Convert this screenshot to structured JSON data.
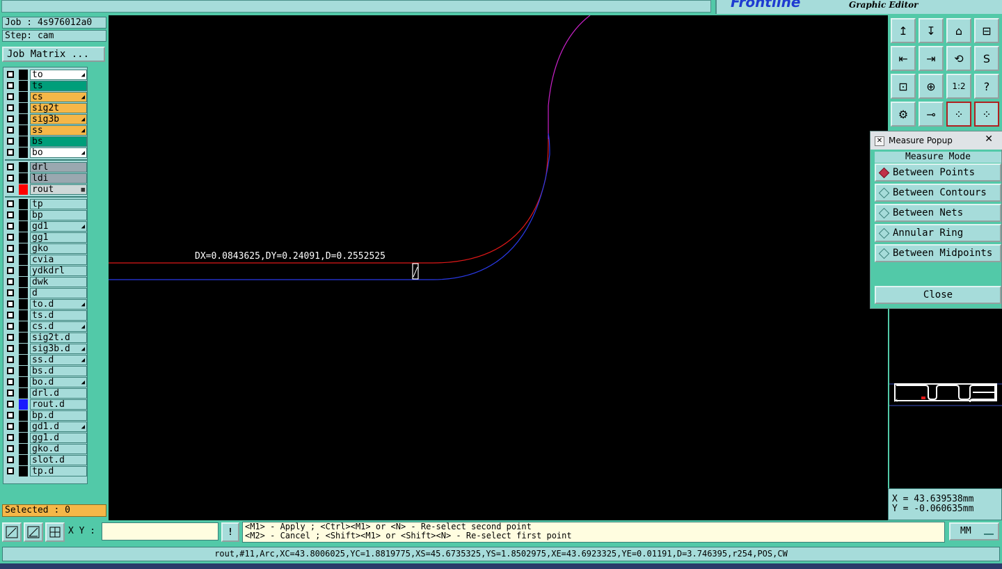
{
  "app": {
    "editor_title": "Graphic Editor",
    "logo_text": "Frontline"
  },
  "job": {
    "label": "Job : 4s976012a0",
    "step": "Step: cam",
    "matrix_button": "Job Matrix ..."
  },
  "layers": [
    {
      "name": "to",
      "bg": "#ffffff",
      "swatch": "#000000",
      "mark": "◢"
    },
    {
      "name": "ts",
      "bg": "#009e7a",
      "swatch": "#000000",
      "mark": ""
    },
    {
      "name": "cs",
      "bg": "#f5b748",
      "swatch": "#000000",
      "mark": "◢"
    },
    {
      "name": "sig2t",
      "bg": "#f5b748",
      "swatch": "#000000",
      "mark": ""
    },
    {
      "name": "sig3b",
      "bg": "#f5b748",
      "swatch": "#000000",
      "mark": "◢"
    },
    {
      "name": "ss",
      "bg": "#f5b748",
      "swatch": "#000000",
      "mark": "◢"
    },
    {
      "name": "bs",
      "bg": "#009e7a",
      "swatch": "#000000",
      "mark": ""
    },
    {
      "name": "bo",
      "bg": "#ffffff",
      "swatch": "#000000",
      "mark": "◢"
    },
    {
      "name": "drl",
      "bg": "#9aa8b0",
      "swatch": "#000000",
      "mark": ""
    },
    {
      "name": "ldi",
      "bg": "#9aa8b0",
      "swatch": "#000000",
      "mark": ""
    },
    {
      "name": "rout",
      "bg": "#cfd8d8",
      "swatch": "#ff0000",
      "mark": "▦"
    },
    {
      "name": "tp",
      "bg": "#a6dcda",
      "swatch": "#000000",
      "mark": ""
    },
    {
      "name": "bp",
      "bg": "#a6dcda",
      "swatch": "#000000",
      "mark": ""
    },
    {
      "name": "gd1",
      "bg": "#a6dcda",
      "swatch": "#000000",
      "mark": "◢"
    },
    {
      "name": "gg1",
      "bg": "#a6dcda",
      "swatch": "#000000",
      "mark": ""
    },
    {
      "name": "gko",
      "bg": "#a6dcda",
      "swatch": "#000000",
      "mark": ""
    },
    {
      "name": "cvia",
      "bg": "#a6dcda",
      "swatch": "#000000",
      "mark": ""
    },
    {
      "name": "ydkdrl",
      "bg": "#a6dcda",
      "swatch": "#000000",
      "mark": ""
    },
    {
      "name": "dwk",
      "bg": "#a6dcda",
      "swatch": "#000000",
      "mark": ""
    },
    {
      "name": "d",
      "bg": "#a6dcda",
      "swatch": "#000000",
      "mark": ""
    },
    {
      "name": "to.d",
      "bg": "#a6dcda",
      "swatch": "#000000",
      "mark": "◢"
    },
    {
      "name": "ts.d",
      "bg": "#a6dcda",
      "swatch": "#000000",
      "mark": ""
    },
    {
      "name": "cs.d",
      "bg": "#a6dcda",
      "swatch": "#000000",
      "mark": "◢"
    },
    {
      "name": "sig2t.d",
      "bg": "#a6dcda",
      "swatch": "#000000",
      "mark": ""
    },
    {
      "name": "sig3b.d",
      "bg": "#a6dcda",
      "swatch": "#000000",
      "mark": "◢"
    },
    {
      "name": "ss.d",
      "bg": "#a6dcda",
      "swatch": "#000000",
      "mark": "◢"
    },
    {
      "name": "bs.d",
      "bg": "#a6dcda",
      "swatch": "#000000",
      "mark": ""
    },
    {
      "name": "bo.d",
      "bg": "#a6dcda",
      "swatch": "#000000",
      "mark": "◢"
    },
    {
      "name": "drl.d",
      "bg": "#a6dcda",
      "swatch": "#000000",
      "mark": ""
    },
    {
      "name": "rout.d",
      "bg": "#a6dcda",
      "swatch": "#1a1aff",
      "mark": ""
    },
    {
      "name": "bp.d",
      "bg": "#a6dcda",
      "swatch": "#000000",
      "mark": ""
    },
    {
      "name": "gd1.d",
      "bg": "#a6dcda",
      "swatch": "#000000",
      "mark": "◢"
    },
    {
      "name": "gg1.d",
      "bg": "#a6dcda",
      "swatch": "#000000",
      "mark": ""
    },
    {
      "name": "gko.d",
      "bg": "#a6dcda",
      "swatch": "#000000",
      "mark": ""
    },
    {
      "name": "slot.d",
      "bg": "#a6dcda",
      "swatch": "#000000",
      "mark": ""
    },
    {
      "name": "tp.d",
      "bg": "#a6dcda",
      "swatch": "#000000",
      "mark": ""
    }
  ],
  "selected": "Selected : 0",
  "canvas": {
    "measure_text": "DX=0.0843625,DY=0.24091,D=0.2552525"
  },
  "toolbar_icons": [
    "↥",
    "↧",
    "⌂",
    "⊟",
    "⇤",
    "⇥",
    "⟲",
    "S",
    "⊡",
    "⊕",
    "1:2",
    "?",
    "⚙",
    "⊸",
    "⁘",
    "⁘"
  ],
  "popup": {
    "title": "Measure Popup",
    "mode_title": "Measure Mode",
    "modes": [
      "Between Points",
      "Between Contours",
      "Between Nets",
      "Annular Ring",
      "Between Midpoints"
    ],
    "selected_mode": 0,
    "close_label": "Close"
  },
  "coords": {
    "x": "X = 43.639538mm",
    "y": "Y = -0.060635mm"
  },
  "bottom": {
    "xy_label": "X Y :",
    "xy_value": "",
    "alert_icon": "!",
    "msg_line1": "<M1> - Apply  ; <Ctrl><M1> or <N> - Re-select second point",
    "msg_line2": "<M2> - Cancel ; <Shift><M1> or <Shift><N> - Re-select first point",
    "units": "MM"
  },
  "status": "rout,#11,Arc,XC=43.8006025,YC=1.8819775,XS=45.6735325,YS=1.8502975,XE=43.6923325,YE=0.01191,D=3.746395,r254,POS,CW",
  "colors": {
    "teal": "#52c9a8",
    "panel": "#a6dcda",
    "red_trace": "#e01818",
    "blue_trace": "#2a3ae8",
    "magenta": "#cc22cc"
  }
}
